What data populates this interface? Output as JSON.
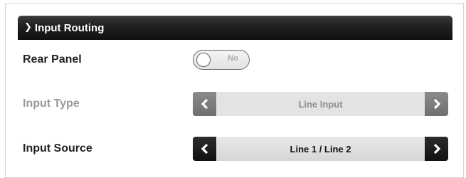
{
  "panel": {
    "title": "Input Routing",
    "collapse_icon": "chevron-down-icon"
  },
  "rows": {
    "rear_panel": {
      "label": "Rear Panel",
      "toggle_state": "No"
    },
    "input_type": {
      "label": "Input Type",
      "value": "Line Input",
      "enabled": false
    },
    "input_source": {
      "label": "Input Source",
      "value": "Line 1 / Line 2",
      "enabled": true
    }
  },
  "icons": {
    "prev": "chevron-left-icon",
    "next": "chevron-right-icon"
  }
}
